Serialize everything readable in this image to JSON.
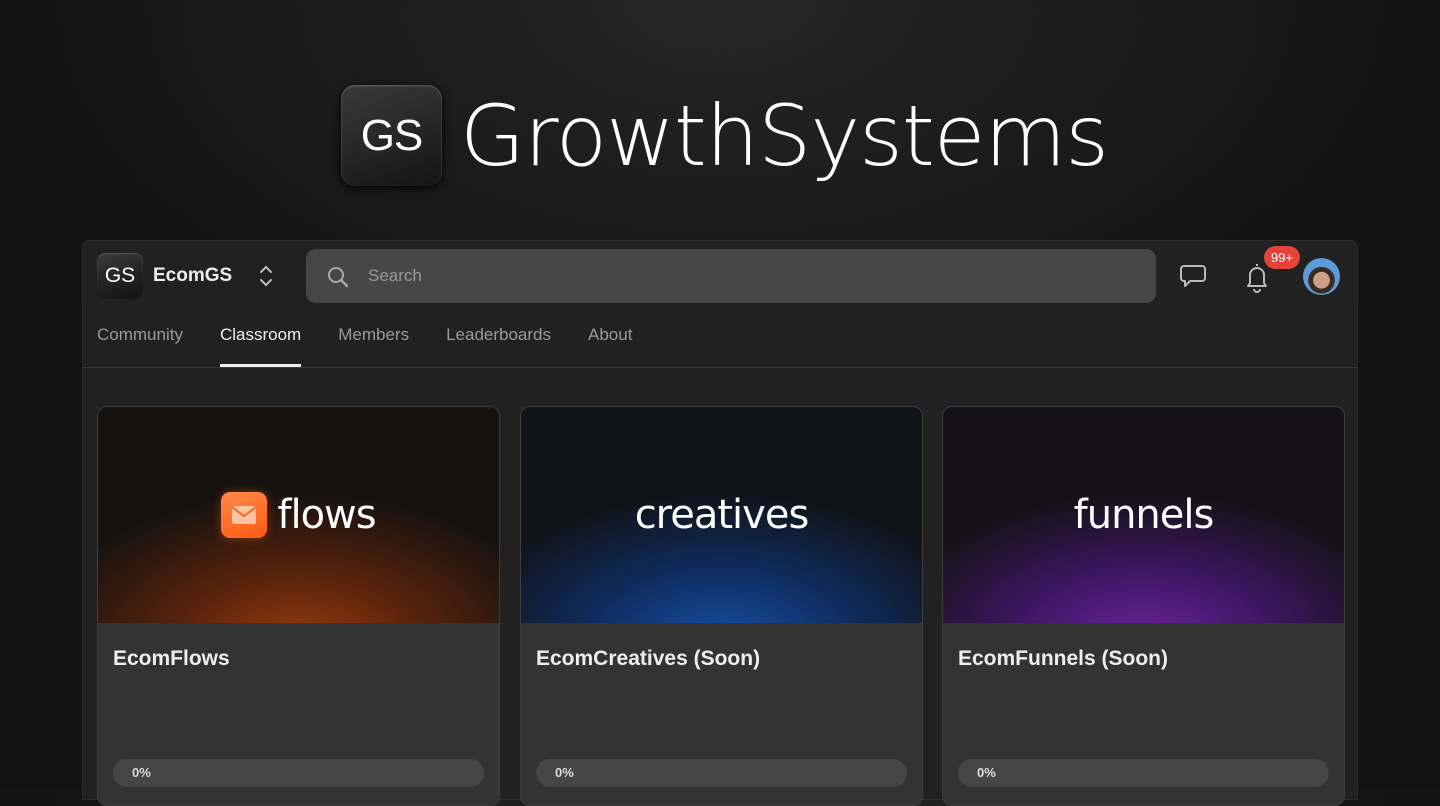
{
  "hero": {
    "logo_text": "GS",
    "title": "GrowthSystems"
  },
  "header": {
    "logo_text": "GS",
    "community_name": "EcomGS",
    "search_placeholder": "Search",
    "notification_count": "99+"
  },
  "tabs": [
    {
      "label": "Community"
    },
    {
      "label": "Classroom",
      "active": true
    },
    {
      "label": "Members"
    },
    {
      "label": "Leaderboards"
    },
    {
      "label": "About"
    }
  ],
  "courses": [
    {
      "banner": "flows",
      "title": "EcomFlows",
      "progress_label": "0%",
      "progress": 0,
      "accent": "#ff6a1f"
    },
    {
      "banner": "creatives",
      "title": "EcomCreatives (Soon)",
      "progress_label": "0%",
      "progress": 0,
      "accent": "#1850a8"
    },
    {
      "banner": "funnels",
      "title": "EcomFunnels (Soon)",
      "progress_label": "0%",
      "progress": 0,
      "accent": "#6c23a0"
    }
  ]
}
